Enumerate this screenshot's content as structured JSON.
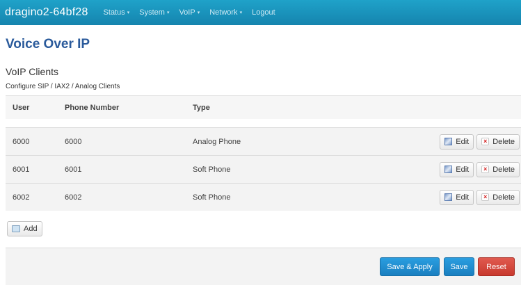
{
  "header": {
    "hostname": "dragino2-64bf28",
    "nav": [
      {
        "label": "Status",
        "caret": "▾"
      },
      {
        "label": "System",
        "caret": "▾"
      },
      {
        "label": "VoIP",
        "caret": "▾"
      },
      {
        "label": "Network",
        "caret": "▾"
      },
      {
        "label": "Logout",
        "caret": ""
      }
    ]
  },
  "page": {
    "title": "Voice Over IP",
    "section_title": "VoIP Clients",
    "section_desc": "Configure SIP / IAX2 / Analog Clients"
  },
  "table": {
    "columns": [
      "User",
      "Phone Number",
      "Type"
    ],
    "rows": [
      {
        "user": "6000",
        "phone": "6000",
        "type": "Analog Phone"
      },
      {
        "user": "6001",
        "phone": "6001",
        "type": "Soft Phone"
      },
      {
        "user": "6002",
        "phone": "6002",
        "type": "Soft Phone"
      }
    ],
    "edit_label": "Edit",
    "delete_label": "Delete"
  },
  "actions": {
    "add_label": "Add",
    "save_apply_label": "Save & Apply",
    "save_label": "Save",
    "reset_label": "Reset"
  },
  "colors": {
    "topbar": "#1a93bf",
    "title": "#2a5a9b",
    "primary_button": "#1f8ed0",
    "reset_button": "#d4473c"
  }
}
